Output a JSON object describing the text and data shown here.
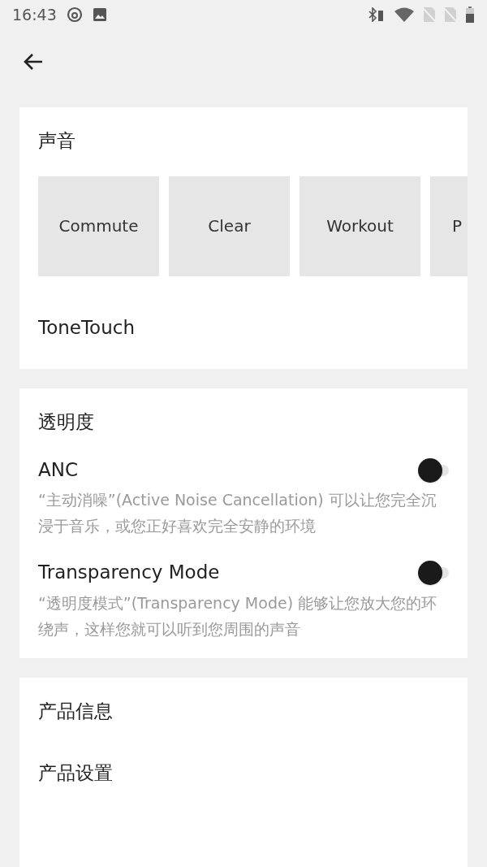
{
  "status_bar": {
    "time": "16:43"
  },
  "sound": {
    "title": "声音",
    "presets": [
      {
        "label": "Commute"
      },
      {
        "label": "Clear"
      },
      {
        "label": "Workout"
      },
      {
        "label": "P"
      }
    ],
    "tonetouch": "ToneTouch"
  },
  "transparency": {
    "title": "透明度",
    "options": [
      {
        "label": "ANC",
        "on": false,
        "description": "“主动消噪”(Active Noise Cancellation) 可以让您完全沉浸于音乐，或您正好喜欢完全安静的环境"
      },
      {
        "label": "Transparency Mode",
        "on": false,
        "description": "“透明度模式”(Transparency Mode) 能够让您放大您的环绕声，这样您就可以听到您周围的声音"
      }
    ]
  },
  "product": {
    "items": [
      "产品信息",
      "产品设置"
    ]
  }
}
